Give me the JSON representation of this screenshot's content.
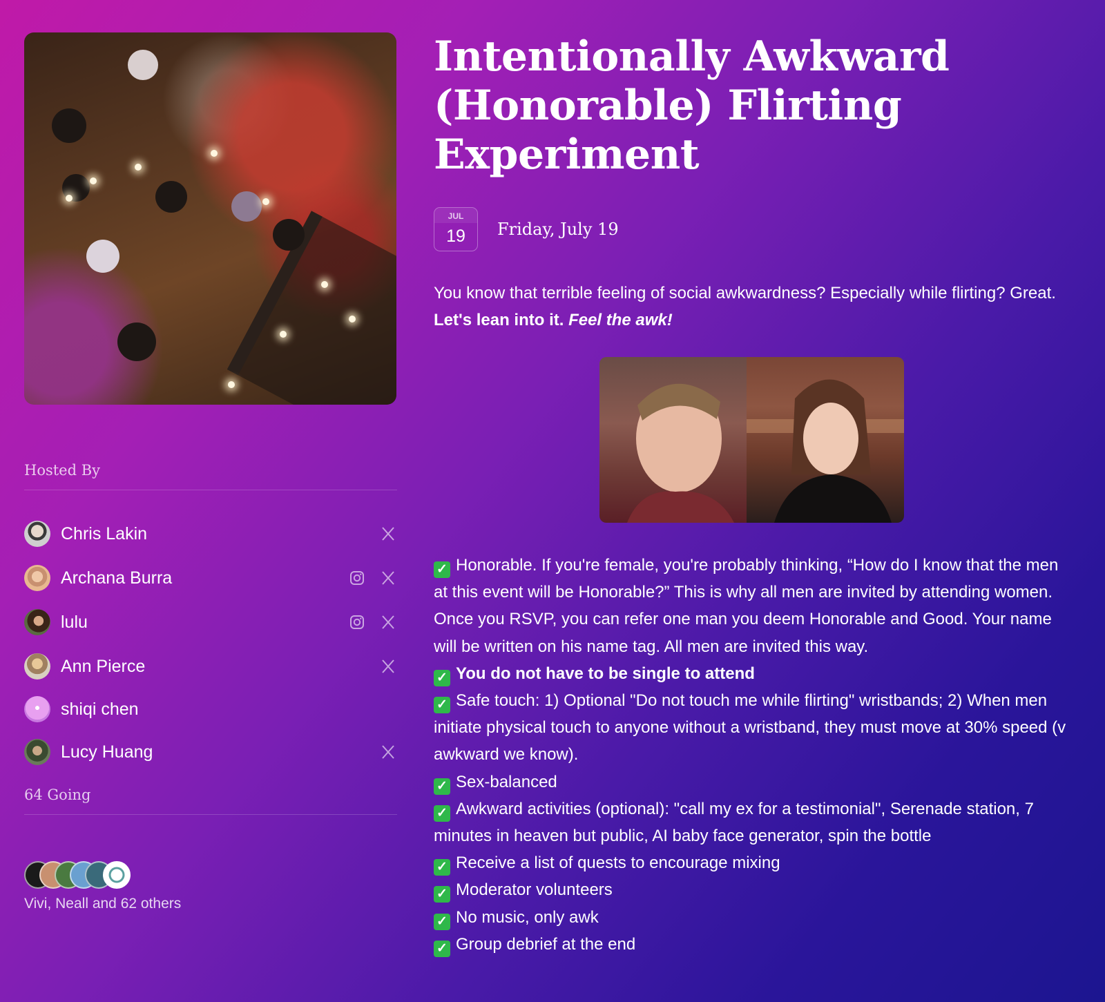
{
  "event": {
    "title": "Intentionally Awkward (Honorable) Flirting Experiment",
    "date_month": "JUL",
    "date_day": "19",
    "date_text": "Friday, July 19"
  },
  "hosted_by": {
    "label": "Hosted By",
    "hosts": [
      {
        "name": "Chris Lakin",
        "socials": [
          "x-icon"
        ]
      },
      {
        "name": "Archana Burra",
        "socials": [
          "instagram-icon",
          "x-icon"
        ]
      },
      {
        "name": "lulu",
        "socials": [
          "instagram-icon",
          "x-icon"
        ]
      },
      {
        "name": "Ann Pierce",
        "socials": [
          "x-icon"
        ]
      },
      {
        "name": "shiqi chen",
        "socials": []
      },
      {
        "name": "Lucy Huang",
        "socials": [
          "x-icon"
        ]
      }
    ]
  },
  "attendance": {
    "label": "64 Going",
    "summary": "Vivi, Neall and 62 others"
  },
  "description": {
    "intro_plain": "You know that terrible feeling of social awkwardness? Especially while flirting? Great. ",
    "intro_bold": "Let's lean into it. ",
    "intro_bold_italic": "Feel the awk!",
    "check_symbol": "✓",
    "features": [
      {
        "text": "Honorable. If you're female, you're probably thinking, “How do I know that the men at this event will be Honorable?” This is why all men are invited by attending women. Once you RSVP, you can refer one man you deem Honorable and Good. Your name will be written on his name tag. All men are invited this way.",
        "bold": false
      },
      {
        "text": "You do not have to be single to attend",
        "bold": true
      },
      {
        "text": "Safe touch: 1) Optional \"Do not touch me while flirting\" wristbands; 2) When men initiate physical touch to anyone without a wristband, they must move at 30% speed (v awkward we know).",
        "bold": false
      },
      {
        "text": "Sex-balanced",
        "bold": false
      },
      {
        "text": "Awkward activities (optional): \"call my ex for a testimonial\", Serenade station, 7 minutes in heaven but public, AI baby face generator, spin the bottle",
        "bold": false
      },
      {
        "text": "Receive a list of quests to encourage mixing",
        "bold": false
      },
      {
        "text": "Moderator volunteers",
        "bold": false
      },
      {
        "text": "No music, only awk",
        "bold": false
      },
      {
        "text": "Group debrief at the end",
        "bold": false
      }
    ]
  },
  "colors": {
    "gradient_start": "#c01aa8",
    "gradient_end": "#1c1590",
    "check_green": "#2fb84a"
  }
}
